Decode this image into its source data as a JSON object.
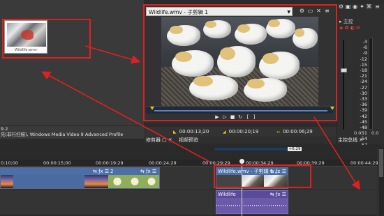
{
  "media": {
    "thumb_caption": "Wildlife.wmv",
    "info_line1": "9.2",
    "info_line2": "先(非行扫描), Windows Media Video 9 Advanced Profile"
  },
  "preview": {
    "title": "Wildlife.wmv - 子剪辑 1",
    "timecode_in": "00:00:13;20",
    "timecode_out": "00:00:20;19",
    "timecode_len": "00:00:06;29",
    "tab_trimmer": "修剪器",
    "tab_preview": "视频预览"
  },
  "right_panel": {
    "label": "主控",
    "meter_scale": [
      "-3",
      "-6",
      "-9",
      "-12",
      "-15",
      "-18",
      "-21",
      "-24",
      "-27",
      "-30",
      "-33",
      "-36",
      "-39",
      "-42",
      "-45",
      "-48",
      "-51",
      "-54",
      "-57"
    ],
    "meter_bottom": [
      "0.0",
      "0.0"
    ],
    "bus_label": "主控总线"
  },
  "timeline": {
    "ruler": [
      "0:10;00",
      "00:00:15;00",
      "00:00:19;29",
      "00:00:24;29",
      "00:00:29;29",
      "00:00:34;29",
      "00:00:39;29",
      "00:00:44;29"
    ],
    "marker_value": "+6;29",
    "clip_video_a_label": "2",
    "clip_selected_label": "Wildlife.wmv - 子剪辑 1 ...",
    "clip_audio_label": "Wildlife"
  },
  "colors": {
    "annotation_red": "#e02020",
    "clip_blue": "#4b6fa6",
    "audio_purple": "#6a5aa8",
    "marker_yellow": "#e8c020"
  },
  "icons": {
    "play": "play-icon",
    "stop": "stop-icon",
    "loop": "loop-icon"
  }
}
